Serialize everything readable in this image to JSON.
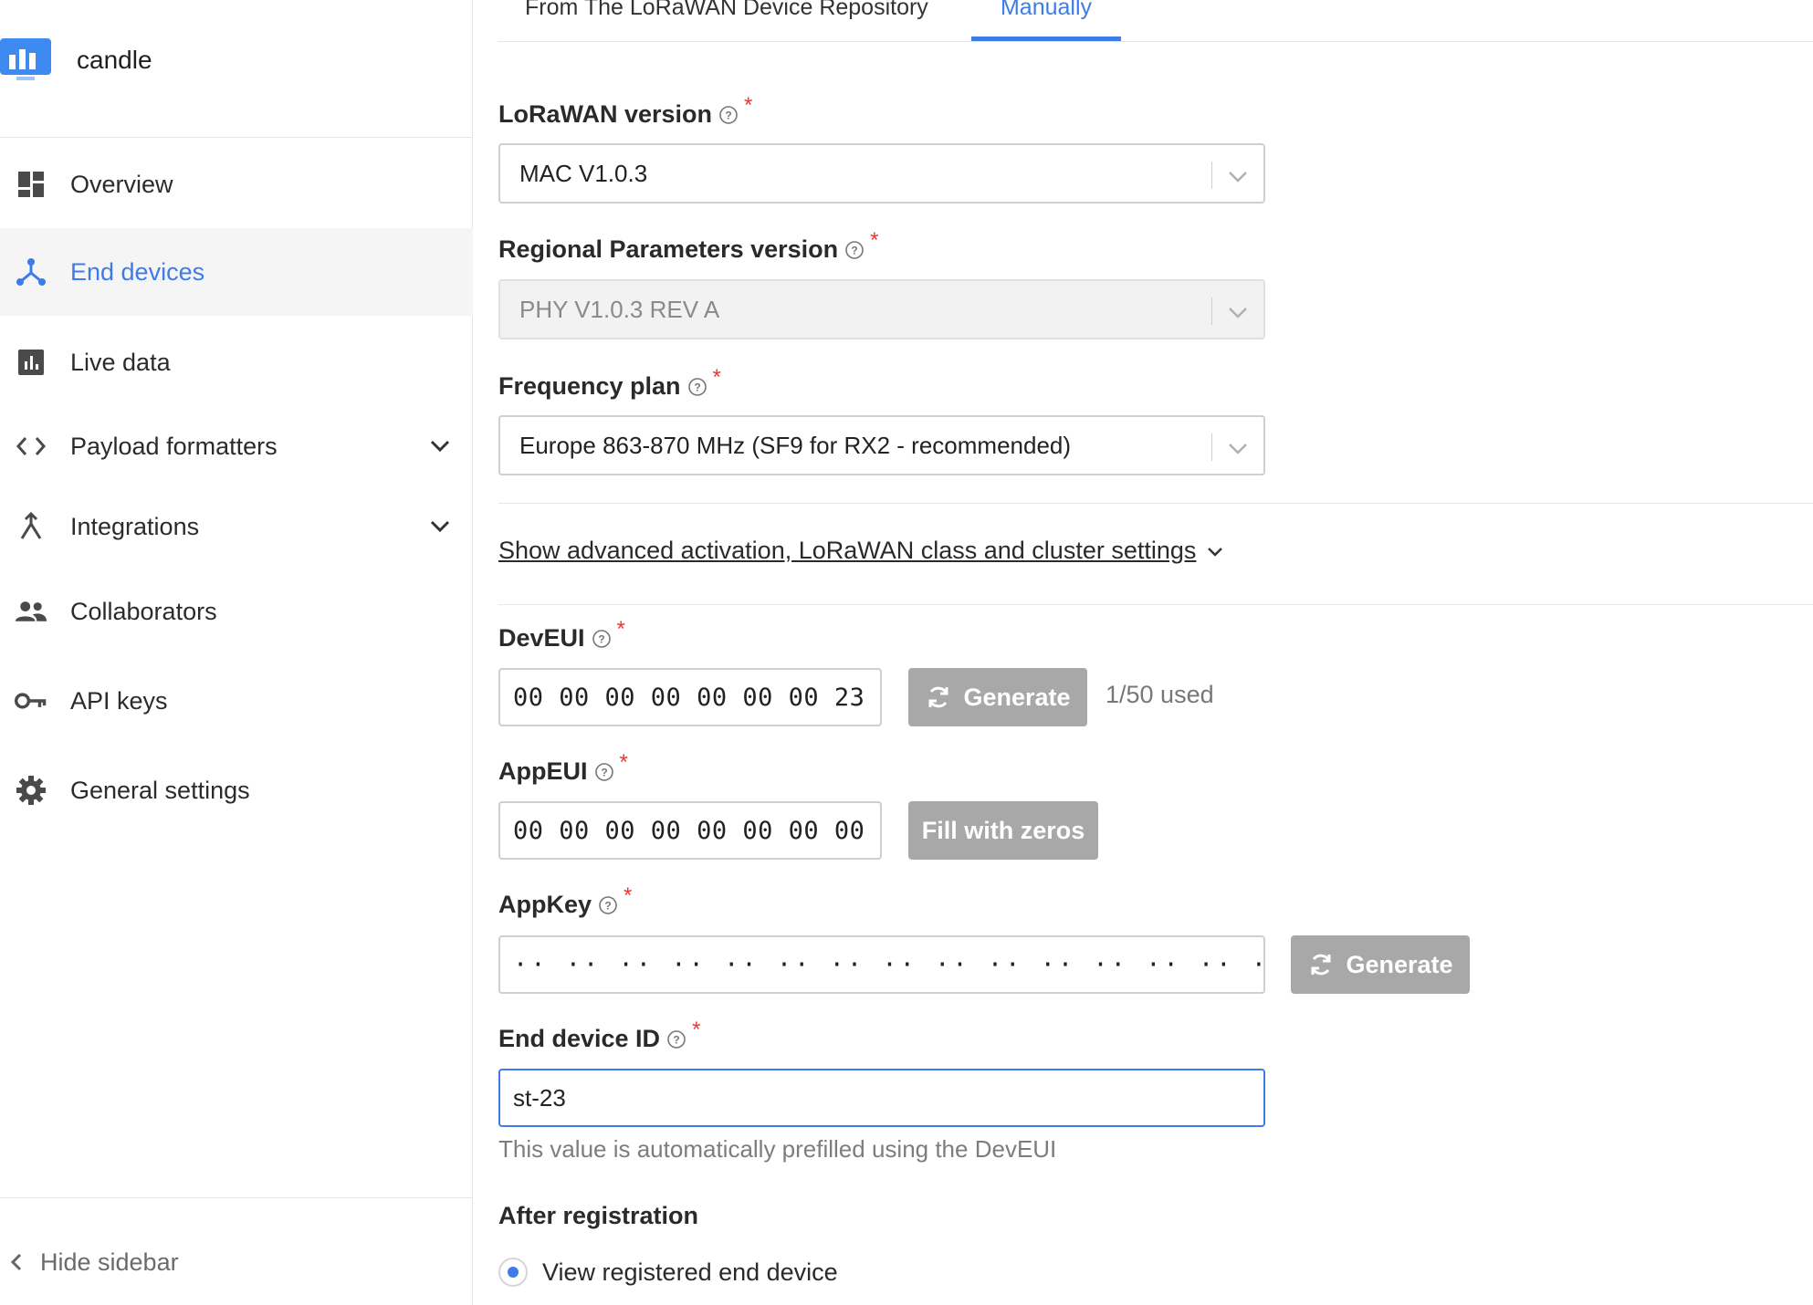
{
  "app": {
    "name": "candle"
  },
  "sidebar": {
    "items": [
      {
        "label": "Overview",
        "icon": "dashboard-icon",
        "active": false
      },
      {
        "label": "End devices",
        "icon": "devices-icon",
        "active": true
      },
      {
        "label": "Live data",
        "icon": "bar-chart-icon",
        "active": false
      },
      {
        "label": "Payload formatters",
        "icon": "code-icon",
        "active": false,
        "expandable": true
      },
      {
        "label": "Integrations",
        "icon": "merge-icon",
        "active": false,
        "expandable": true
      },
      {
        "label": "Collaborators",
        "icon": "people-icon",
        "active": false
      },
      {
        "label": "API keys",
        "icon": "key-icon",
        "active": false
      },
      {
        "label": "General settings",
        "icon": "gear-icon",
        "active": false
      }
    ],
    "hide_label": "Hide sidebar"
  },
  "tabs": {
    "repository": "From The LoRaWAN Device Repository",
    "manual": "Manually",
    "active": "manual"
  },
  "form": {
    "lorawan_version": {
      "label": "LoRaWAN version",
      "value": "MAC V1.0.3"
    },
    "regional_params": {
      "label": "Regional Parameters version",
      "value": "PHY V1.0.3 REV A"
    },
    "frequency_plan": {
      "label": "Frequency plan",
      "value": "Europe 863-870 MHz (SF9 for RX2 - recommended)"
    },
    "advanced_link": "Show advanced activation, LoRaWAN class and cluster settings",
    "dev_eui": {
      "label": "DevEUI",
      "value": "00 00 00 00 00 00 00 23",
      "button": "Generate",
      "usage": "1/50 used"
    },
    "app_eui": {
      "label": "AppEUI",
      "value": "00 00 00 00 00 00 00 00",
      "button": "Fill with zeros"
    },
    "app_key": {
      "label": "AppKey",
      "value": "·· ·· ·· ·· ·· ·· ·· ·· ·· ·· ·· ·· ·· ·· ·· ··",
      "button": "Generate"
    },
    "end_device_id": {
      "label": "End device ID",
      "value": "st-23",
      "hint": "This value is automatically prefilled using the DevEUI"
    },
    "after_registration": {
      "title": "After registration",
      "option": "View registered end device"
    }
  },
  "colors": {
    "accent": "#3d7ce8",
    "required": "#e53935",
    "button_disabled": "#a8a8a8"
  }
}
